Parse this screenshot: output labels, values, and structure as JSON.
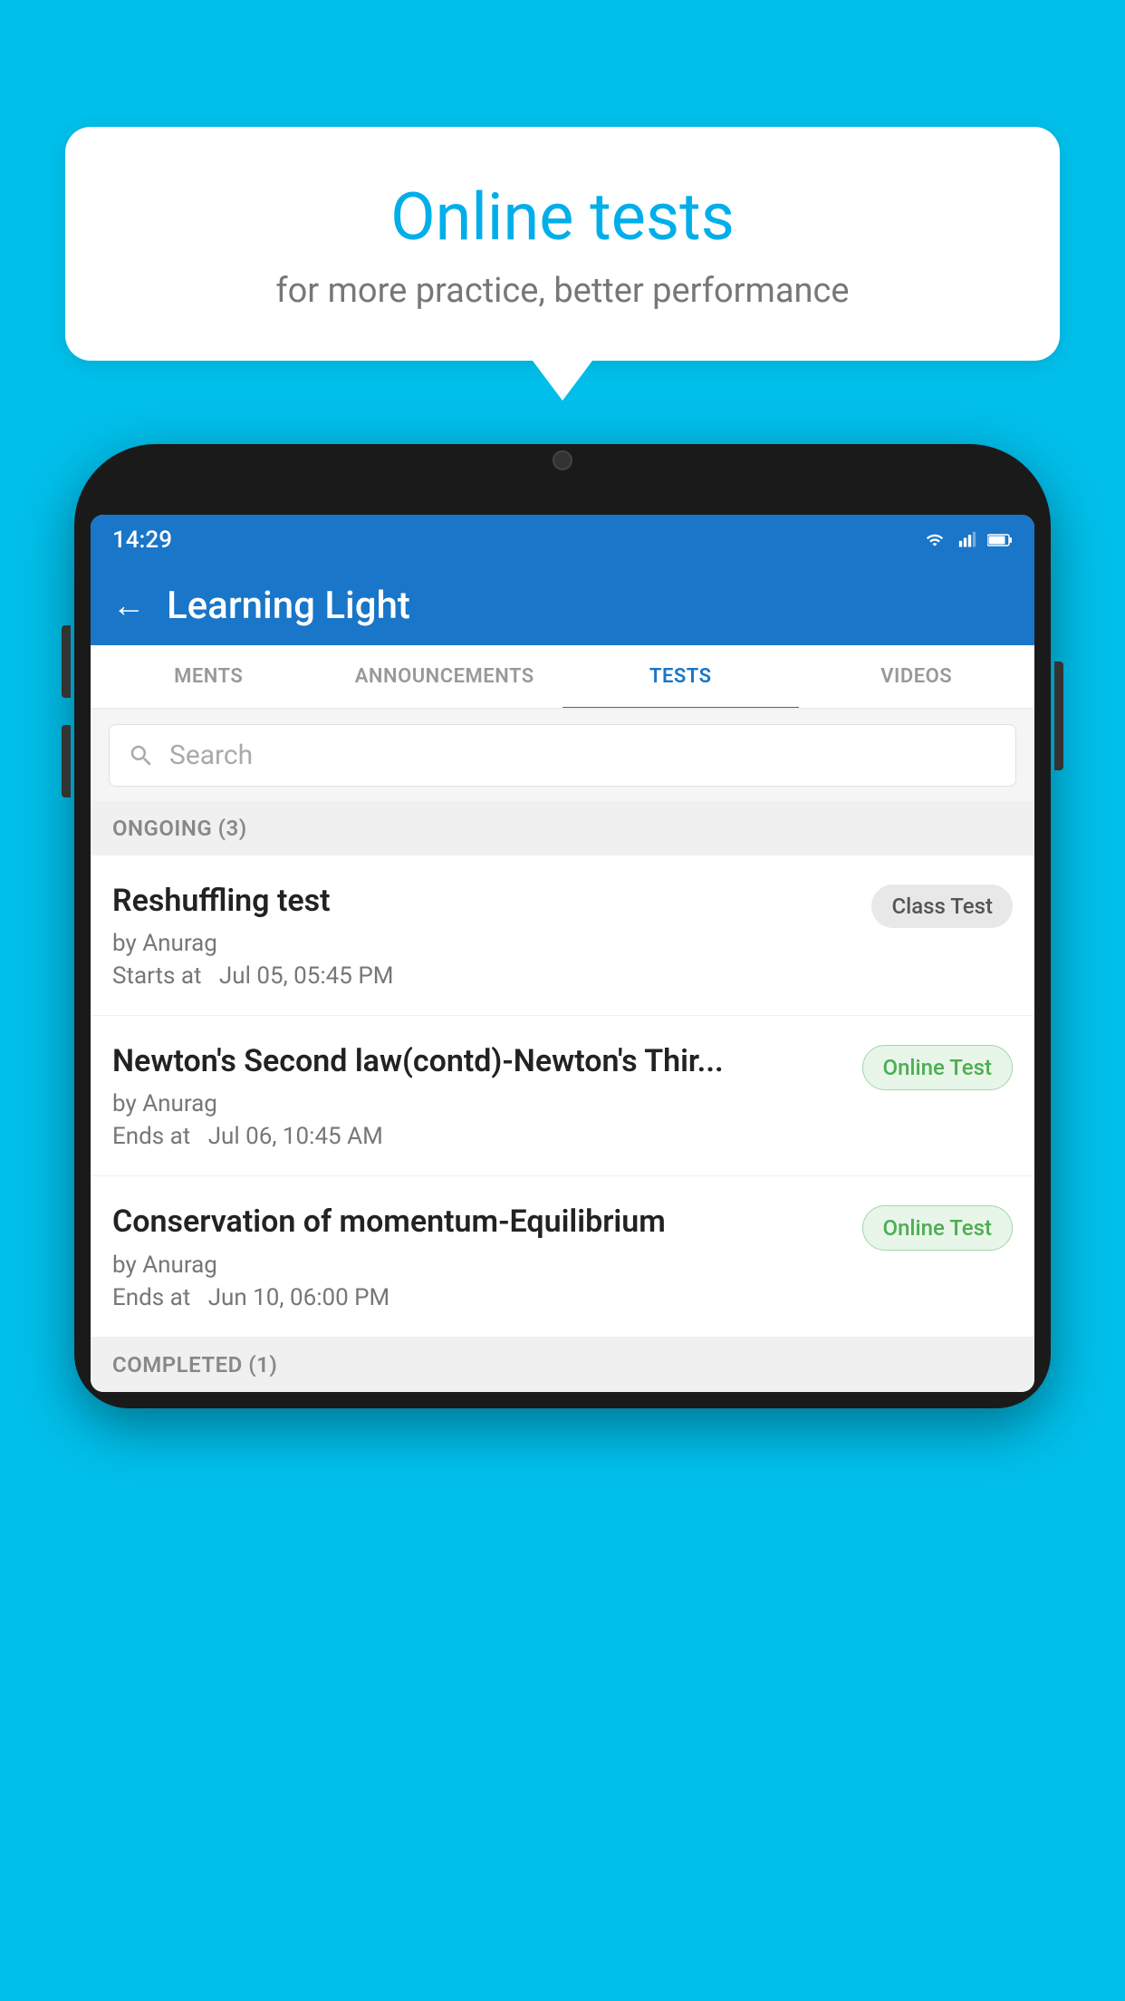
{
  "background_color": "#00BFEA",
  "speech_bubble": {
    "title": "Online tests",
    "subtitle": "for more practice, better performance"
  },
  "phone": {
    "status_bar": {
      "time": "14:29",
      "wifi": "wifi",
      "signal": "signal",
      "battery": "battery"
    },
    "header": {
      "back_label": "←",
      "title": "Learning Light"
    },
    "tabs": [
      {
        "label": "MENTS",
        "active": false
      },
      {
        "label": "ANNOUNCEMENTS",
        "active": false
      },
      {
        "label": "TESTS",
        "active": true
      },
      {
        "label": "VIDEOS",
        "active": false
      }
    ],
    "search": {
      "placeholder": "Search"
    },
    "ongoing_section": {
      "header": "ONGOING (3)",
      "tests": [
        {
          "name": "Reshuffling test",
          "author": "by Anurag",
          "time_label": "Starts at",
          "time": "Jul 05, 05:45 PM",
          "badge": "Class Test",
          "badge_type": "class"
        },
        {
          "name": "Newton's Second law(contd)-Newton's Thir...",
          "author": "by Anurag",
          "time_label": "Ends at",
          "time": "Jul 06, 10:45 AM",
          "badge": "Online Test",
          "badge_type": "online"
        },
        {
          "name": "Conservation of momentum-Equilibrium",
          "author": "by Anurag",
          "time_label": "Ends at",
          "time": "Jun 10, 06:00 PM",
          "badge": "Online Test",
          "badge_type": "online"
        }
      ]
    },
    "completed_section": {
      "header": "COMPLETED (1)"
    }
  }
}
